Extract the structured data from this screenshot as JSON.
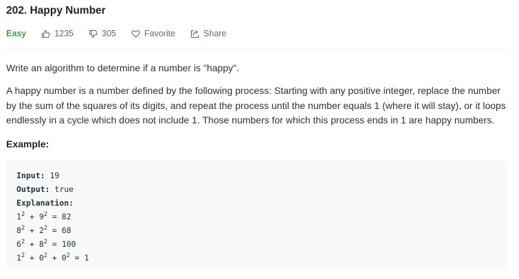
{
  "problem": {
    "title": "202. Happy Number",
    "difficulty": "Easy",
    "likes": "1235",
    "dislikes": "305",
    "favorite_label": "Favorite",
    "share_label": "Share"
  },
  "description": {
    "intro": "Write an algorithm to determine if a number is \"happy\".",
    "body": "A happy number is a number defined by the following process: Starting with any positive integer, replace the number by the sum of the squares of its digits, and repeat the process until the number equals 1 (where it will stay), or it loops endlessly in a cycle which does not include 1. Those numbers for which this process ends in 1 are happy numbers."
  },
  "example": {
    "label": "Example:",
    "input_label": "Input:",
    "input_value": "19",
    "output_label": "Output:",
    "output_value": "true",
    "explanation_label": "Explanation:",
    "steps": [
      {
        "terms": [
          {
            "base": "1",
            "exp": "2"
          },
          {
            "base": "9",
            "exp": "2"
          }
        ],
        "result": "82"
      },
      {
        "terms": [
          {
            "base": "8",
            "exp": "2"
          },
          {
            "base": "2",
            "exp": "2"
          }
        ],
        "result": "68"
      },
      {
        "terms": [
          {
            "base": "6",
            "exp": "2"
          },
          {
            "base": "8",
            "exp": "2"
          }
        ],
        "result": "100"
      },
      {
        "terms": [
          {
            "base": "1",
            "exp": "2"
          },
          {
            "base": "0",
            "exp": "2"
          },
          {
            "base": "0",
            "exp": "2"
          }
        ],
        "result": "1"
      }
    ]
  },
  "icons": {
    "like": "thumbs-up-icon",
    "dislike": "thumbs-down-icon",
    "favorite": "heart-icon",
    "share": "share-icon"
  },
  "colors": {
    "easy": "#43a047",
    "code_bg": "#f7f9fa"
  }
}
